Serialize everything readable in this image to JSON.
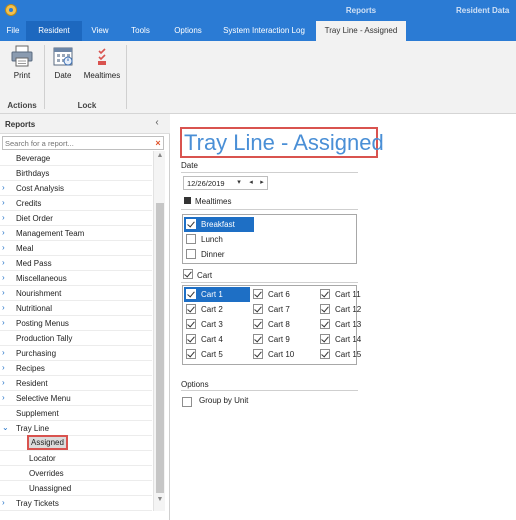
{
  "titlebar": {
    "context_group": "Reports",
    "right_text": "Resident Data"
  },
  "ribbon_tabs": [
    {
      "label": "File"
    },
    {
      "label": "Resident"
    },
    {
      "label": "View"
    },
    {
      "label": "Tools"
    },
    {
      "label": "Options"
    },
    {
      "label": "System Interaction Log"
    },
    {
      "label": "Tray Line - Assigned"
    }
  ],
  "ribbon": {
    "actions": {
      "group_label": "Actions",
      "print_label": "Print"
    },
    "lock": {
      "group_label": "Lock",
      "date_label": "Date",
      "mealtimes_label": "Mealtimes"
    }
  },
  "left_panel": {
    "title": "Reports",
    "collapse_glyph": "‹",
    "search_placeholder": "Search for a report...",
    "tree": [
      {
        "label": "Beverage",
        "expander": ""
      },
      {
        "label": "Birthdays",
        "expander": ""
      },
      {
        "label": "Cost Analysis",
        "expander": "›"
      },
      {
        "label": "Credits",
        "expander": "›"
      },
      {
        "label": "Diet Order",
        "expander": "›"
      },
      {
        "label": "Management Team",
        "expander": "›"
      },
      {
        "label": "Meal",
        "expander": "›"
      },
      {
        "label": "Med Pass",
        "expander": "›"
      },
      {
        "label": "Miscellaneous",
        "expander": "›"
      },
      {
        "label": "Nourishment",
        "expander": "›"
      },
      {
        "label": "Nutritional",
        "expander": "›"
      },
      {
        "label": "Posting Menus",
        "expander": "›"
      },
      {
        "label": "Production Tally",
        "expander": ""
      },
      {
        "label": "Purchasing",
        "expander": "›"
      },
      {
        "label": "Recipes",
        "expander": "›"
      },
      {
        "label": "Resident",
        "expander": "›"
      },
      {
        "label": "Selective Menu",
        "expander": "›"
      },
      {
        "label": "Supplement",
        "expander": ""
      },
      {
        "label": "Tray Line",
        "expander": "⌄"
      },
      {
        "label": "Assigned",
        "expander": ""
      },
      {
        "label": "Locator",
        "expander": ""
      },
      {
        "label": "Overrides",
        "expander": ""
      },
      {
        "label": "Unassigned",
        "expander": ""
      },
      {
        "label": "Tray Tickets",
        "expander": "›"
      }
    ]
  },
  "main": {
    "title": "Tray Line - Assigned",
    "date_section": {
      "label": "Date",
      "value": "12/26/2019",
      "dropdown_glyph": "▾",
      "prev_glyph": "◂",
      "next_glyph": "▸"
    },
    "mealtimes_section": {
      "label": "Mealtimes",
      "items": [
        {
          "label": "Breakfast",
          "checked": true
        },
        {
          "label": "Lunch",
          "checked": false
        },
        {
          "label": "Dinner",
          "checked": false
        }
      ]
    },
    "cart_section": {
      "label": "Cart",
      "items": [
        {
          "label": "Cart 1"
        },
        {
          "label": "Cart 2"
        },
        {
          "label": "Cart 3"
        },
        {
          "label": "Cart 4"
        },
        {
          "label": "Cart 5"
        },
        {
          "label": "Cart 6"
        },
        {
          "label": "Cart 7"
        },
        {
          "label": "Cart 8"
        },
        {
          "label": "Cart 9"
        },
        {
          "label": "Cart 10"
        },
        {
          "label": "Cart 11"
        },
        {
          "label": "Cart 12"
        },
        {
          "label": "Cart 13"
        },
        {
          "label": "Cart 14"
        },
        {
          "label": "Cart 15"
        }
      ]
    },
    "options_section": {
      "label": "Options",
      "group_by_unit_label": "Group by Unit",
      "group_by_unit_checked": false
    }
  },
  "colors": {
    "titlebar": "#2b7bd4",
    "accent_blue": "#1e6fc5",
    "highlight_red": "#d9534f",
    "title_text": "#4a8fd6"
  }
}
